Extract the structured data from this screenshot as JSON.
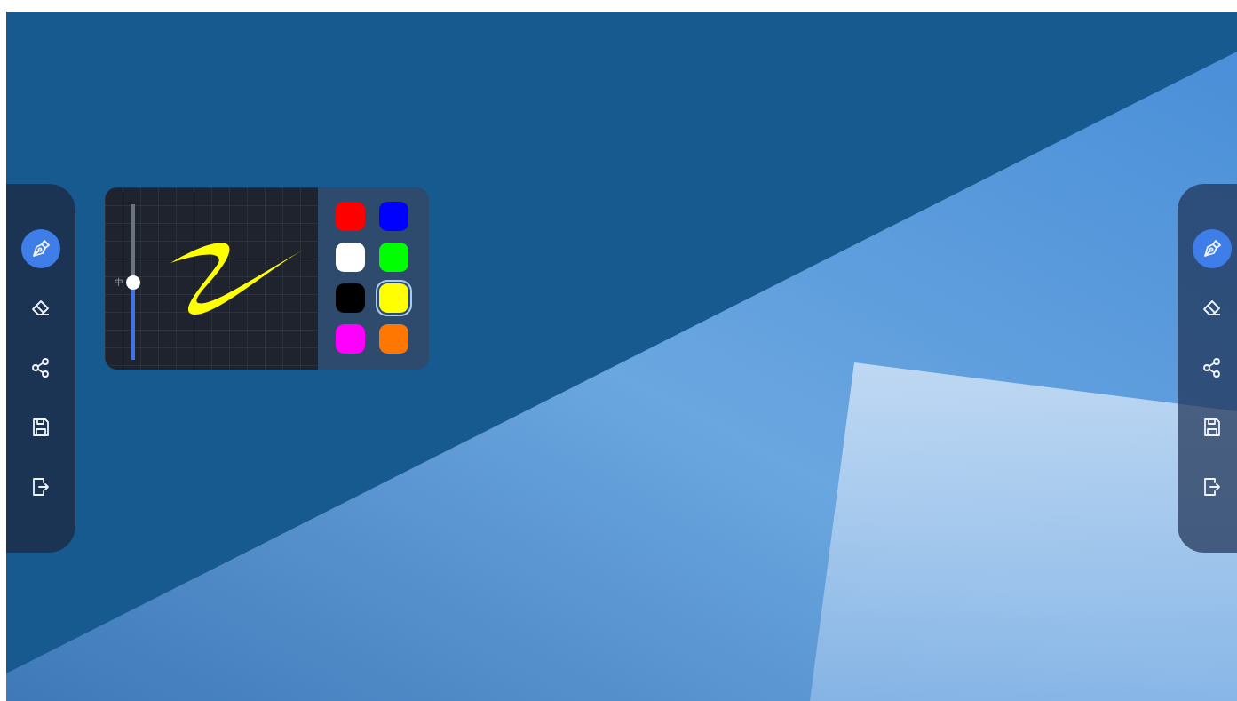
{
  "toolbars": [
    {
      "tools": [
        {
          "kind": "pen",
          "selected": true
        },
        {
          "kind": "eraser",
          "selected": false
        },
        {
          "kind": "share",
          "selected": false
        },
        {
          "kind": "save",
          "selected": false
        },
        {
          "kind": "exit",
          "selected": false
        }
      ]
    },
    {
      "tools": [
        {
          "kind": "pen",
          "selected": true
        },
        {
          "kind": "eraser",
          "selected": false
        },
        {
          "kind": "share",
          "selected": false
        },
        {
          "kind": "save",
          "selected": false
        },
        {
          "kind": "exit",
          "selected": false
        }
      ]
    }
  ],
  "pen_panel": {
    "size_label": "中",
    "level": 0.5,
    "colors": [
      {
        "color": "#ff0000",
        "selected": false
      },
      {
        "color": "#0000ff",
        "selected": false
      },
      {
        "color": "#ffffff",
        "selected": false
      },
      {
        "color": "#00ff00",
        "selected": false
      },
      {
        "color": "#000000",
        "selected": false
      },
      {
        "color": "#ffff00",
        "selected": true
      },
      {
        "color": "#ff00ff",
        "selected": false
      },
      {
        "color": "#ff7700",
        "selected": false
      }
    ]
  }
}
